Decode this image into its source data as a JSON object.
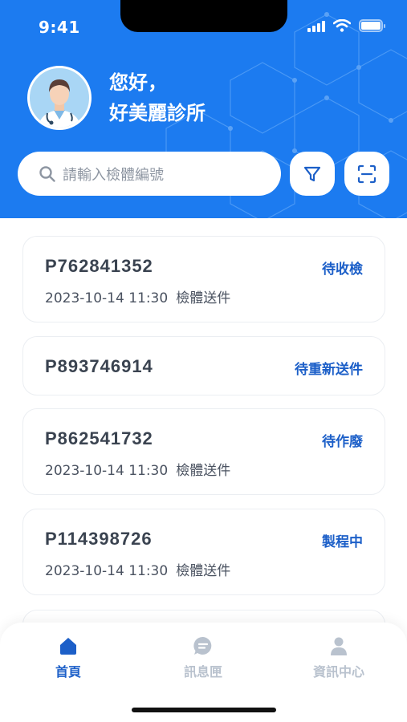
{
  "status_bar": {
    "time": "9:41"
  },
  "header": {
    "greeting_line1": "您好，",
    "greeting_line2": "好美麗診所"
  },
  "search": {
    "placeholder": "請輸入檢體編號",
    "search_icon": "search-icon",
    "filter_icon": "filter-icon",
    "scan_icon": "scan-icon"
  },
  "specimens": [
    {
      "id": "P762841352",
      "status": "待收檢",
      "date": "2023-10-14 11:30",
      "action": "檢體送件"
    },
    {
      "id": "P893746914",
      "status": "待重新送件"
    },
    {
      "id": "P862541732",
      "status": "待作廢",
      "date": "2023-10-14 11:30",
      "action": "檢體送件"
    },
    {
      "id": "P114398726",
      "status": "製程中",
      "date": "2023-10-14 11:30",
      "action": "檢體送件"
    }
  ],
  "tabbar": {
    "items": [
      {
        "label": "首頁",
        "icon": "home-icon"
      },
      {
        "label": "訊息匣",
        "icon": "chat-icon"
      },
      {
        "label": "資訊中心",
        "icon": "user-icon"
      }
    ]
  },
  "colors": {
    "primary": "#1C7BF0",
    "status_text": "#1C5FC8",
    "tab_active": "#1C5FC8",
    "tab_inactive": "#B9C2CE"
  }
}
